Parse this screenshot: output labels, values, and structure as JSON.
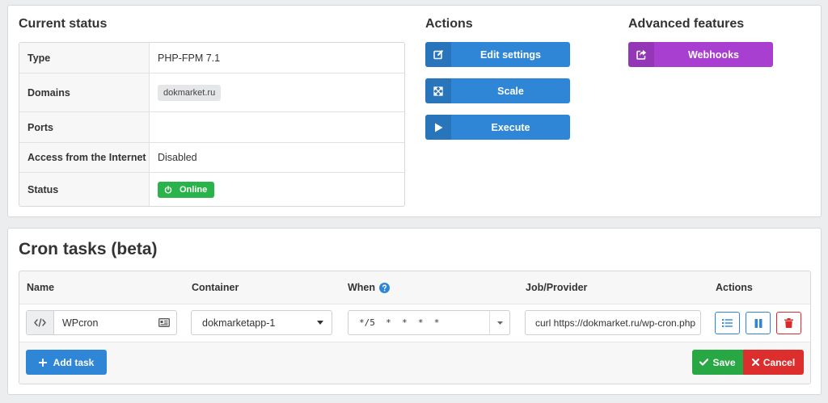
{
  "status_section": {
    "title": "Current status",
    "rows": [
      {
        "key": "Type",
        "value": "PHP-FPM 7.1"
      },
      {
        "key": "Domains",
        "value": "dokmarket.ru"
      },
      {
        "key": "Ports",
        "value": ""
      },
      {
        "key": "Access from the Internet",
        "value": "Disabled"
      },
      {
        "key": "Status",
        "value": "Online"
      }
    ],
    "status_color": "#2ab34a"
  },
  "actions_section": {
    "title": "Actions",
    "buttons": [
      {
        "label": "Edit settings",
        "icon": "edit-icon"
      },
      {
        "label": "Scale",
        "icon": "expand-icon"
      },
      {
        "label": "Execute",
        "icon": "play-icon"
      }
    ],
    "color": "#2f86d6"
  },
  "advanced_section": {
    "title": "Advanced features",
    "buttons": [
      {
        "label": "Webhooks",
        "icon": "share-icon"
      }
    ],
    "color": "#a83fd0"
  },
  "cron_section": {
    "title": "Cron tasks (beta)",
    "columns": {
      "name": "Name",
      "container": "Container",
      "when": "When",
      "job": "Job/Provider",
      "actions": "Actions"
    },
    "row": {
      "name": "WPcron",
      "container": "dokmarketapp-1",
      "when": "*/5  *  *  *  *",
      "job": "curl https://dokmarket.ru/wp-cron.php"
    },
    "add_task_label": "Add task",
    "save_label": "Save",
    "cancel_label": "Cancel"
  }
}
